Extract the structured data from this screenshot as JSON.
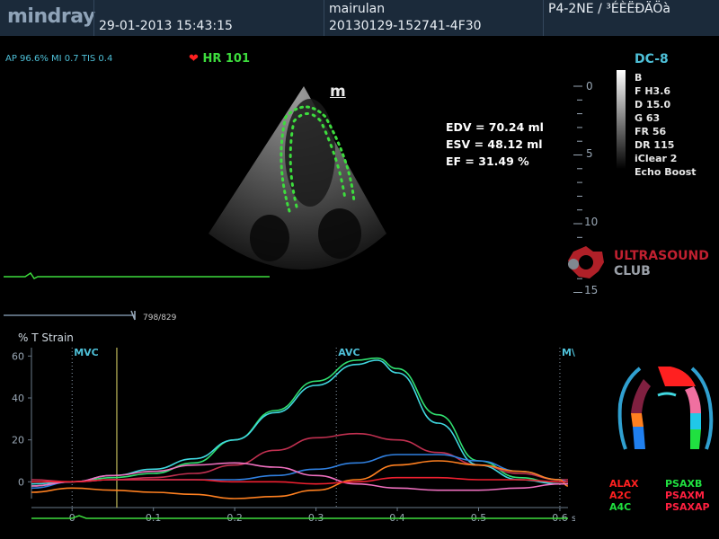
{
  "header": {
    "brand": "mindray",
    "date": "29-01-2013",
    "time": "15:43:15",
    "operator": "mairulan",
    "exam_id": "20130129-152741-4F30",
    "probe_preset": "P4-2NE / ³ÉÈËÐÄÖà"
  },
  "status": {
    "ap_mi_tis": "AP 96.6%  MI 0.7 TIS 0.4",
    "hr_label": "HR 101",
    "view_marker": "m"
  },
  "params": {
    "model": "DC-8",
    "mode": "B",
    "freq": "F H3.6",
    "depth": "D 15.0",
    "gain": "G 63",
    "fr": "FR 56",
    "dr": "DR 115",
    "iclear": "iClear 2",
    "boost": "Echo Boost"
  },
  "measurements": {
    "edv": "EDV = 70.24 ml",
    "esv": "ESV = 48.12 ml",
    "ef": "EF  = 31.49 %"
  },
  "depth_scale": [
    "0",
    "5",
    "10",
    "15"
  ],
  "watermark": {
    "line1": "ULTRASOUND",
    "line2": "CLUB"
  },
  "cine": {
    "frame": "798/829"
  },
  "colors": {
    "header_bg": "#1b2a3a",
    "ecg": "#3ddc3d",
    "accent_cyan": "#4ec0d8",
    "segment_red": "#ff2020",
    "segment_green": "#20e040"
  },
  "chart_data": {
    "type": "line",
    "title": "% T Strain",
    "xlabel": "s",
    "ylabel": "",
    "xlim": [
      -0.05,
      0.61
    ],
    "ylim": [
      -8,
      64
    ],
    "x_ticks": [
      "0",
      "0.1",
      "0.2",
      "0.3",
      "0.4",
      "0.5",
      "0.6"
    ],
    "y_ticks": [
      "60",
      "40",
      "20",
      "0"
    ],
    "events": [
      {
        "label": "MVC",
        "x": 0.0
      },
      {
        "label": "AVC",
        "x": 0.325
      },
      {
        "label": "M\\",
        "x": 0.6
      }
    ],
    "cursor_x": 0.055,
    "series": [
      {
        "color": "#30e070",
        "x": [
          -0.05,
          0.0,
          0.05,
          0.1,
          0.15,
          0.2,
          0.25,
          0.3,
          0.35,
          0.375,
          0.4,
          0.45,
          0.5,
          0.55,
          0.6,
          0.61
        ],
        "y": [
          -2,
          0,
          2,
          4,
          9,
          20,
          34,
          48,
          58,
          59,
          54,
          32,
          10,
          2,
          -1,
          -1
        ]
      },
      {
        "color": "#40d8e0",
        "x": [
          -0.05,
          0.0,
          0.05,
          0.1,
          0.15,
          0.2,
          0.25,
          0.3,
          0.35,
          0.375,
          0.4,
          0.45,
          0.5,
          0.55,
          0.6,
          0.61
        ],
        "y": [
          -1,
          0,
          3,
          6,
          11,
          20,
          33,
          46,
          56,
          58,
          52,
          28,
          8,
          1,
          -1,
          -1
        ]
      },
      {
        "color": "#c03050",
        "x": [
          -0.05,
          0.0,
          0.05,
          0.1,
          0.15,
          0.2,
          0.25,
          0.3,
          0.35,
          0.4,
          0.45,
          0.5,
          0.55,
          0.6,
          0.61
        ],
        "y": [
          1,
          0,
          1,
          2,
          4,
          8,
          15,
          21,
          23,
          20,
          14,
          8,
          4,
          1,
          1
        ]
      },
      {
        "color": "#3080e0",
        "x": [
          -0.05,
          0.0,
          0.05,
          0.1,
          0.15,
          0.2,
          0.25,
          0.3,
          0.35,
          0.4,
          0.45,
          0.5,
          0.55,
          0.6,
          0.61
        ],
        "y": [
          -3,
          0,
          1,
          1,
          1,
          1,
          3,
          6,
          9,
          13,
          13,
          10,
          5,
          1,
          0
        ]
      },
      {
        "color": "#ff8020",
        "x": [
          -0.05,
          0.0,
          0.05,
          0.1,
          0.15,
          0.2,
          0.25,
          0.3,
          0.35,
          0.4,
          0.45,
          0.5,
          0.55,
          0.6,
          0.61
        ],
        "y": [
          -5,
          -3,
          -4,
          -5,
          -6,
          -8,
          -7,
          -4,
          1,
          8,
          10,
          8,
          5,
          1,
          -2
        ]
      },
      {
        "color": "#f070c0",
        "x": [
          -0.05,
          0.0,
          0.05,
          0.1,
          0.15,
          0.2,
          0.25,
          0.3,
          0.35,
          0.4,
          0.45,
          0.5,
          0.55,
          0.6,
          0.61
        ],
        "y": [
          -2,
          0,
          3,
          5,
          8,
          9,
          7,
          3,
          -1,
          -3,
          -4,
          -4,
          -3,
          -1,
          -1
        ]
      },
      {
        "color": "#f02030",
        "x": [
          -0.05,
          0.0,
          0.05,
          0.1,
          0.15,
          0.2,
          0.25,
          0.3,
          0.35,
          0.4,
          0.45,
          0.5,
          0.55,
          0.6,
          0.61
        ],
        "y": [
          0,
          0,
          1,
          1,
          1,
          0,
          0,
          -1,
          0,
          2,
          2,
          1,
          1,
          0,
          0
        ]
      }
    ]
  },
  "segment_legend": [
    {
      "label": "ALAX",
      "color": "#ff2020"
    },
    {
      "label": "PSAXB",
      "color": "#20e040"
    },
    {
      "label": "A2C",
      "color": "#ff2020"
    },
    {
      "label": "PSAXM",
      "color": "#ff2040"
    },
    {
      "label": "A4C",
      "color": "#20e040"
    },
    {
      "label": "PSAXAP",
      "color": "#ff2040"
    }
  ]
}
